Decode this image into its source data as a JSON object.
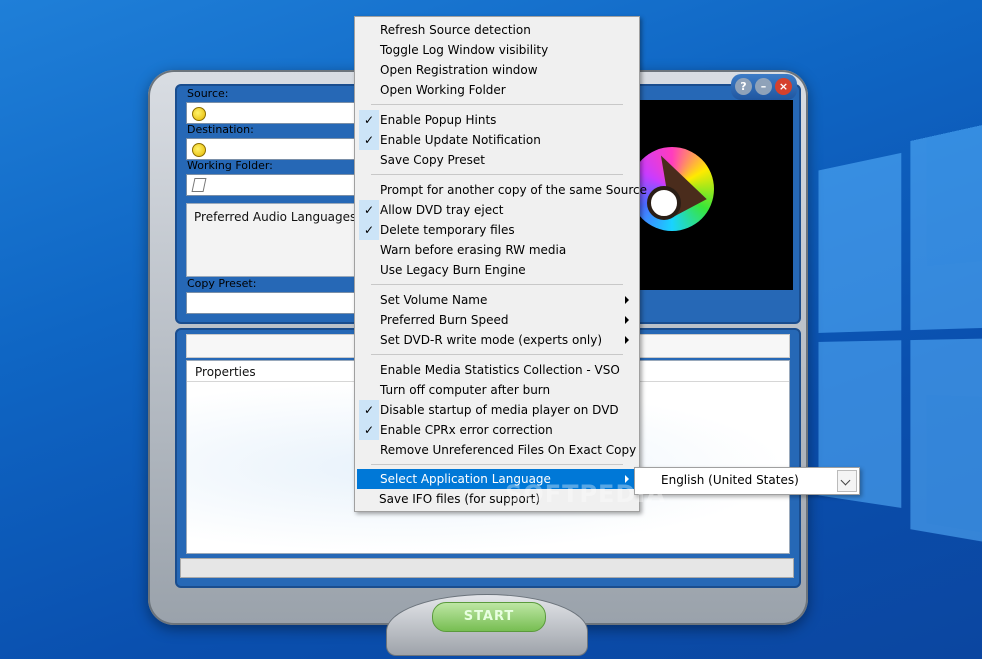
{
  "app": {
    "source_label": "Source:",
    "destination_label": "Destination:",
    "working_folder_label": "Working Folder:",
    "preferred_audio_languages": "Preferred Audio Languages",
    "copy_preset_label": "Copy Preset:",
    "properties_header": "Properties",
    "start_button": "START",
    "window_buttons": {
      "help": "?",
      "minimize": "–",
      "close": "×"
    }
  },
  "menu": {
    "items": [
      {
        "label": "Refresh Source detection",
        "checked": false
      },
      {
        "label": "Toggle Log Window visibility",
        "checked": false
      },
      {
        "label": "Open Registration window",
        "checked": false
      },
      {
        "label": "Open Working Folder",
        "checked": false
      },
      {
        "label": "Enable Popup Hints",
        "checked": true,
        "check": "✓"
      },
      {
        "label": "Enable Update Notification",
        "checked": true,
        "check": "✓"
      },
      {
        "label": "Save Copy Preset",
        "checked": false
      },
      {
        "label": "Prompt for another copy of the same Source",
        "checked": false
      },
      {
        "label": "Allow DVD tray eject",
        "checked": true,
        "check": "✓"
      },
      {
        "label": "Delete temporary files",
        "checked": true,
        "check": "✓"
      },
      {
        "label": "Warn before erasing RW media",
        "checked": false
      },
      {
        "label": "Use Legacy Burn Engine",
        "checked": false
      },
      {
        "label": "Set Volume Name",
        "submenu": true
      },
      {
        "label": "Preferred Burn Speed",
        "submenu": true
      },
      {
        "label": "Set DVD-R write mode (experts only)",
        "submenu": true
      },
      {
        "label": "Enable Media Statistics Collection - VSO",
        "checked": false
      },
      {
        "label": "Turn off computer after burn",
        "checked": false
      },
      {
        "label": "Disable startup of media player on DVD",
        "checked": true,
        "check": "✓"
      },
      {
        "label": "Enable CPRx error correction",
        "checked": true,
        "check": "✓"
      },
      {
        "label": "Remove Unreferenced Files On Exact Copy",
        "checked": false
      },
      {
        "label": "Select Application Language",
        "submenu": true,
        "selected": true
      },
      {
        "label": "Save IFO files (for support)",
        "checked": false
      }
    ]
  },
  "language_dropdown": {
    "value": "English (United States)"
  },
  "watermark": "SOFTPEDIA"
}
